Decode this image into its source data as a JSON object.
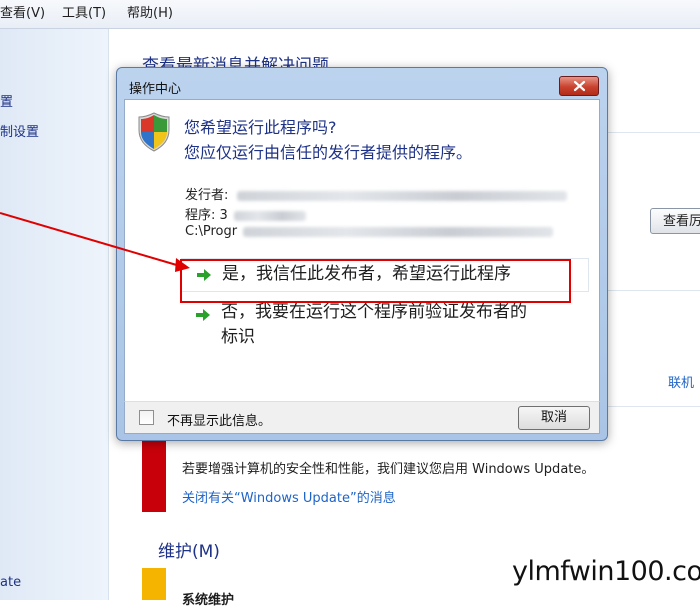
{
  "menubar": {
    "view": "查看(V)",
    "tools": "工具(T)",
    "help": "帮助(H)"
  },
  "leftpane": {
    "item1": "置",
    "item2": "制设置",
    "item3": "ate"
  },
  "main": {
    "title": "查看最新消息并解决问题",
    "view_button": "查看厉",
    "link_right": "联机",
    "windows_update_desc": "若要增强计算机的安全性和性能，我们建议您启用 Windows Update。",
    "windows_update_link": "关闭有关“Windows Update”的消息",
    "maintenance_title": "维护(M)",
    "maintenance_sub": "系统维护"
  },
  "dialog": {
    "title": "操作中心",
    "question1": "您希望运行此程序吗?",
    "question2": "您应仅运行由信任的发行者提供的程序。",
    "publisher_label": "发行者:",
    "program_label": "程序: 3",
    "path_prefix": "C:\\Progr",
    "option_yes": "是，我信任此发布者，希望运行此程序",
    "option_no_line1": "否，我要在运行这个程序前验证发布者的",
    "option_no_line2": "标识",
    "dont_show": "不再显示此信息。",
    "cancel": "取消"
  },
  "watermark": "ylmfwin100.com",
  "colors": {
    "link_blue": "#1e3287",
    "highlight_red": "#e00000",
    "alert_red": "#c8000a",
    "maintenance_yellow": "#f5b400",
    "arrow_green": "#2aa12a"
  }
}
